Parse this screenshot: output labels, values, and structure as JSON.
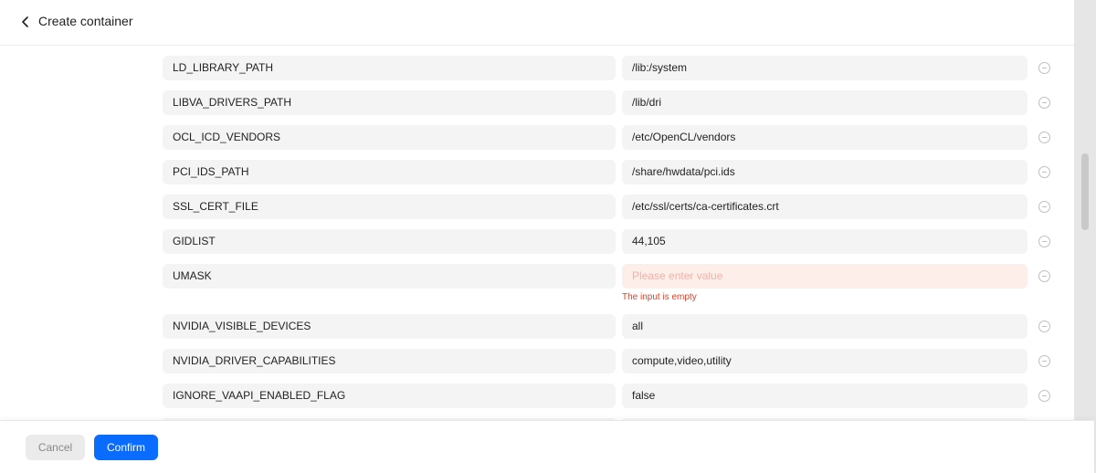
{
  "header": {
    "title": "Create container"
  },
  "env_vars": [
    {
      "key": "LD_LIBRARY_PATH",
      "value": "/lib:/system"
    },
    {
      "key": "LIBVA_DRIVERS_PATH",
      "value": "/lib/dri"
    },
    {
      "key": "OCL_ICD_VENDORS",
      "value": "/etc/OpenCL/vendors"
    },
    {
      "key": "PCI_IDS_PATH",
      "value": "/share/hwdata/pci.ids"
    },
    {
      "key": "SSL_CERT_FILE",
      "value": "/etc/ssl/certs/ca-certificates.crt"
    },
    {
      "key": "GIDLIST",
      "value": "44,105"
    },
    {
      "key": "UMASK",
      "value": "",
      "placeholder": "Please enter value",
      "error": "The input is empty"
    },
    {
      "key": "NVIDIA_VISIBLE_DEVICES",
      "value": "all"
    },
    {
      "key": "NVIDIA_DRIVER_CAPABILITIES",
      "value": "compute,video,utility"
    },
    {
      "key": "IGNORE_VAAPI_ENABLED_FLAG",
      "value": "false"
    }
  ],
  "footer": {
    "cancel_label": "Cancel",
    "confirm_label": "Confirm"
  },
  "colors": {
    "accent": "#0a6cff",
    "error": "#e0402a",
    "error_bg": "#fdeeea"
  }
}
